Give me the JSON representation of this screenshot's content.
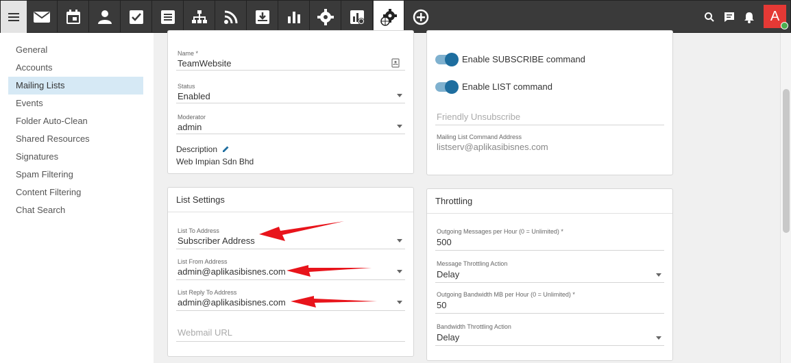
{
  "nav": {
    "icons": [
      "menu-icon",
      "mail-icon",
      "calendar-icon",
      "contacts-icon",
      "tasks-icon",
      "notes-icon",
      "sitemap-icon",
      "rss-icon",
      "archive-icon",
      "reports-icon",
      "settings-icon",
      "domain-reports-icon",
      "domain-settings-icon",
      "add-icon"
    ],
    "right_icons": [
      "search-icon",
      "chat-icon",
      "bell-icon"
    ],
    "avatar_letter": "A"
  },
  "sidebar": {
    "items": [
      "General",
      "Accounts",
      "Mailing Lists",
      "Events",
      "Folder Auto-Clean",
      "Shared Resources",
      "Signatures",
      "Spam Filtering",
      "Content Filtering",
      "Chat Search"
    ],
    "active_index": 2
  },
  "general": {
    "name_label": "Name *",
    "name_value": "TeamWebsite",
    "status_label": "Status",
    "status_value": "Enabled",
    "moderator_label": "Moderator",
    "moderator_value": "admin",
    "description_label": "Description",
    "description_value": "Web Impian Sdn Bhd"
  },
  "commands": {
    "subscribe_label": "Enable SUBSCRIBE command",
    "list_label": "Enable LIST command",
    "friendly_unsubscribe_placeholder": "Friendly Unsubscribe",
    "command_address_label": "Mailing List Command Address",
    "command_address_value": "listserv@aplikasibisnes.com"
  },
  "list_settings": {
    "title": "List Settings",
    "to_label": "List To Address",
    "to_value": "Subscriber Address",
    "from_label": "List From Address",
    "from_value": "admin@aplikasibisnes.com",
    "reply_label": "List Reply To Address",
    "reply_value": "admin@aplikasibisnes.com",
    "webmail_placeholder": "Webmail URL"
  },
  "throttling": {
    "title": "Throttling",
    "msgs_label": "Outgoing Messages per Hour (0 = Unlimited) *",
    "msgs_value": "500",
    "msg_action_label": "Message Throttling Action",
    "msg_action_value": "Delay",
    "bw_label": "Outgoing Bandwidth MB per Hour (0 = Unlimited) *",
    "bw_value": "50",
    "bw_action_label": "Bandwidth Throttling Action",
    "bw_action_value": "Delay"
  },
  "colors": {
    "topbar": "#3a3a3a",
    "accent": "#1e6e9f",
    "sidebar_active": "#d6e9f5",
    "avatar": "#e53935",
    "arrow": "#e8141b"
  }
}
